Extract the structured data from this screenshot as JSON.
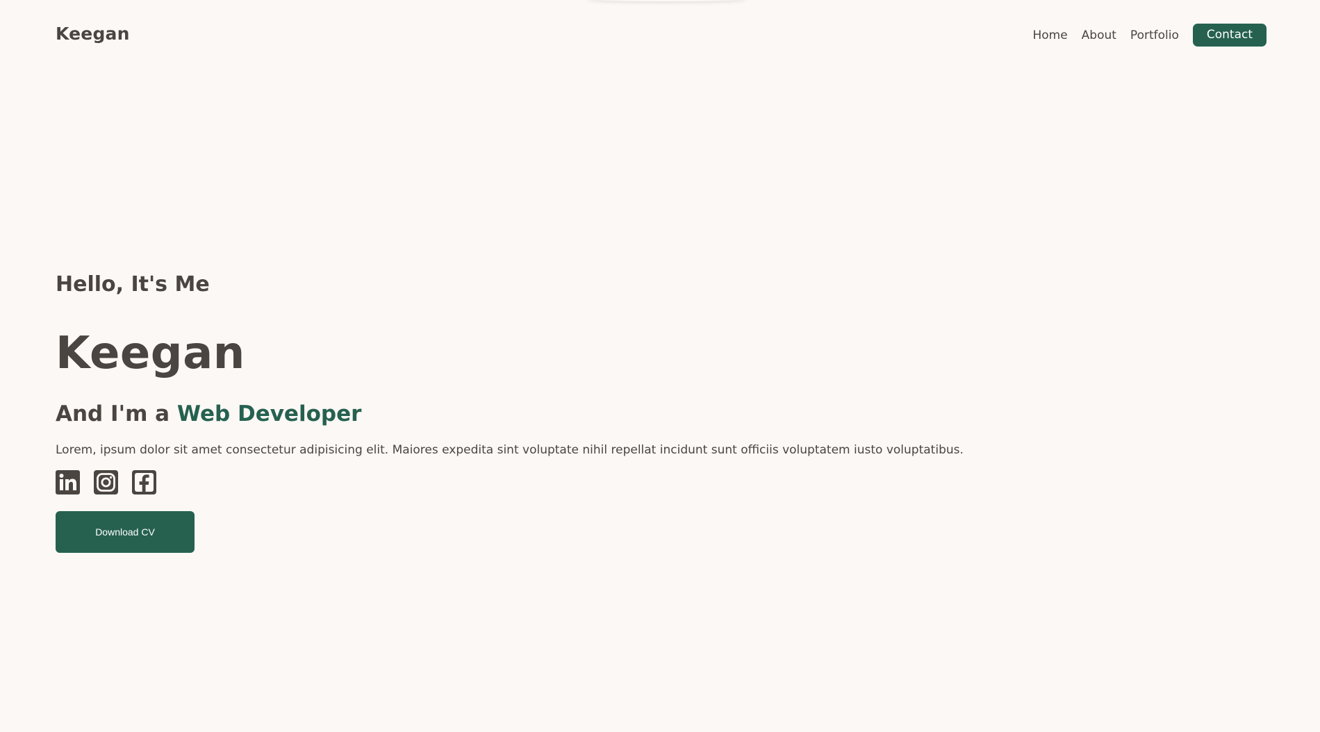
{
  "header": {
    "logo": "Keegan",
    "nav": [
      {
        "label": "Home"
      },
      {
        "label": "About"
      },
      {
        "label": "Portfolio"
      }
    ],
    "contact_label": "Contact"
  },
  "hero": {
    "greeting": "Hello, It's Me",
    "name": "Keegan",
    "role_prefix": "And I'm a ",
    "role_highlight": "Web Developer",
    "bio": "Lorem, ipsum dolor sit amet consectetur adipisicing elit. Maiores expedita sint voluptate nihil repellat incidunt sunt officiis voluptatem iusto voluptatibus.",
    "socials": [
      "linkedin-icon",
      "instagram-icon",
      "facebook-icon"
    ],
    "cv_button": "Download CV"
  },
  "colors": {
    "background": "#fcf8f5",
    "text": "#4a4541",
    "accent": "#266150"
  }
}
